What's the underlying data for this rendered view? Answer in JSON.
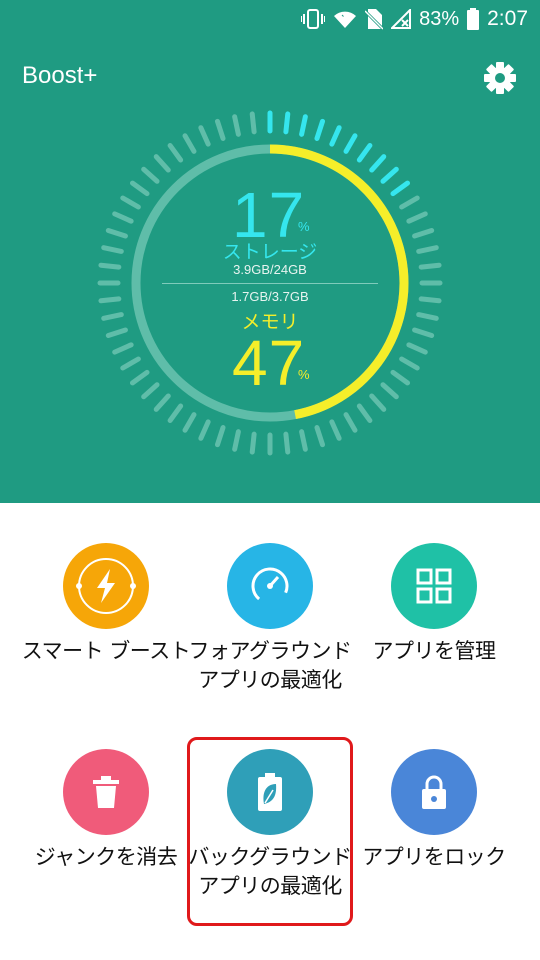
{
  "status_bar": {
    "battery_percent": "83%",
    "time": "2:07",
    "icons": [
      "vibrate-icon",
      "wifi-icon",
      "no-sim-icon",
      "no-signal-icon",
      "battery-icon"
    ]
  },
  "header": {
    "title": "Boost+",
    "settings_icon": "gear-icon"
  },
  "gauge": {
    "storage": {
      "percent": "17",
      "percent_sign": "%",
      "label": "ストレージ",
      "usage": "3.9GB/24GB",
      "color": "#35e6ee"
    },
    "memory": {
      "percent": "47",
      "percent_sign": "%",
      "label": "メモリ",
      "usage": "1.7GB/3.7GB",
      "color": "#f5ee2a"
    },
    "storage_fraction": 0.17,
    "memory_fraction": 0.47
  },
  "colors": {
    "header_bg": "#1f9b82",
    "highlight": "#e0191b"
  },
  "tiles": [
    {
      "label": "スマート ブースト",
      "icon": "lightning-icon",
      "color": "#f6a608"
    },
    {
      "label": "フォアグラウンドアプリの最適化",
      "icon": "speedometer-icon",
      "color": "#27b5e6"
    },
    {
      "label": "アプリを管理",
      "icon": "grid-icon",
      "color": "#1fc1a6"
    },
    {
      "label": "ジャンクを消去",
      "icon": "trash-icon",
      "color": "#f05b7a"
    },
    {
      "label": "バックグラウンドアプリの最適化",
      "icon": "battery-leaf-icon",
      "color": "#2f9fb8"
    },
    {
      "label": "アプリをロック",
      "icon": "lock-icon",
      "color": "#4a86d8"
    }
  ]
}
